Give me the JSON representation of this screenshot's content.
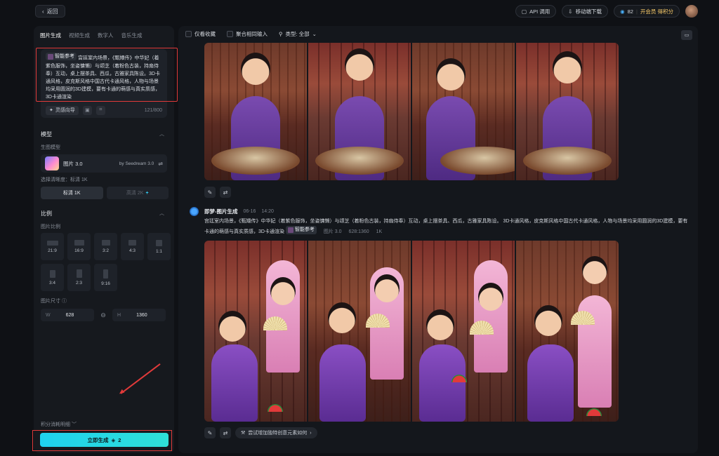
{
  "topbar": {
    "back_label": "返回",
    "api_label": "API 调用",
    "mobile_label": "移动端下载",
    "credits_value": "82",
    "vip_label": "开会员 得积分"
  },
  "left": {
    "tabs": [
      "图片生成",
      "视频生成",
      "数字人",
      "音乐生成"
    ],
    "prompt": {
      "ref_chip": "智能参考",
      "text": "宫廷室内场景，《甄嬛传》中华妃（着紫色服饰，坐姿慵懒）与颂芝（着粉色古装，持扇侍奉）互动，桌上摆茶具、西瓜，古雅家具陈设。3D卡通风格，皮克斯风格中国古代卡通风格，人物与场景均采用圆润的3D建模，要有卡通的萌感与真实质感，3D卡通渲染",
      "inspire_label": "灵感向导",
      "count": "121/800"
    },
    "model_section": {
      "title": "模型",
      "sub_label": "生图模型",
      "model_name": "图片 3.0",
      "model_by": "by Seedream 3.0",
      "clarity_label": "选择清晰度：标清 1K",
      "res_standard": "标清 1K",
      "res_hd": "高清 2K"
    },
    "ratio_section": {
      "title": "比例",
      "sub_label": "图片比例",
      "ratios": [
        "21:9",
        "16:9",
        "3:2",
        "4:3",
        "1:1",
        "3:4",
        "2:3",
        "9:16"
      ],
      "size_label": "图片尺寸",
      "width_prefix": "W",
      "width_value": "628",
      "height_prefix": "H",
      "height_value": "1360"
    },
    "credits_detail": "积分消耗明细",
    "generate_label": "立即生成",
    "generate_cost": "2"
  },
  "main": {
    "filters": {
      "favorites": "仅看收藏",
      "merge_inputs": "聚合相同输入",
      "type_label": "类型: 全部"
    },
    "result2": {
      "title": "即梦-图片生成",
      "date": "06-16",
      "time": "14:20",
      "desc": "宫廷室内场景，《甄嬛传》中华妃（着紫色服饰，坐姿慵懒）与颂芝（着粉色古装，持扇侍奉）互动，桌上摆茶具、西瓜，古雅家具陈设。 3D卡通风格，皮克斯风格中国古代卡通风格，人物与场景均采用圆润的3D建模，要有卡通的萌感与真实质感，3D卡通渲染",
      "ref_chip": "智能参考",
      "model": "图片 3.0",
      "size": "628:1360",
      "res": "1K",
      "suggest_label": "尝试增加独特创意元素如何"
    }
  },
  "colors": {
    "accent": "#1fd1ef",
    "annotation_red": "#e03a3a"
  }
}
